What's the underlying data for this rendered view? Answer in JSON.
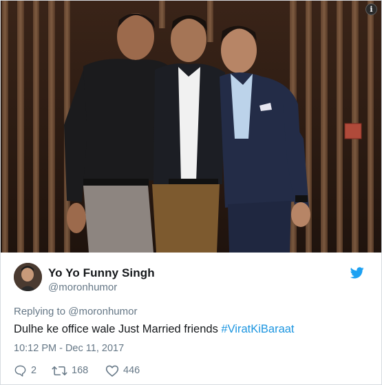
{
  "photo": {
    "description_icon": "info-icon",
    "info_glyph": "i"
  },
  "author": {
    "display_name": "Yo Yo Funny Singh",
    "handle": "@moronhumor",
    "avatar_icon": "avatar"
  },
  "brand": {
    "icon": "twitter-bird-icon",
    "color": "#1da1f2"
  },
  "reply_context": {
    "prefix": "Replying to",
    "handle": "@moronhumor"
  },
  "tweet": {
    "text": "Dulhe ke office wale Just Married friends ",
    "hashtag": "#ViratKiBaraat",
    "timestamp": "10:12 PM - Dec 11, 2017"
  },
  "actions": {
    "reply_count": "2",
    "retweet_count": "168",
    "like_count": "446"
  },
  "colors": {
    "text": "#14171a",
    "secondary": "#657786",
    "link": "#1b95e0"
  }
}
